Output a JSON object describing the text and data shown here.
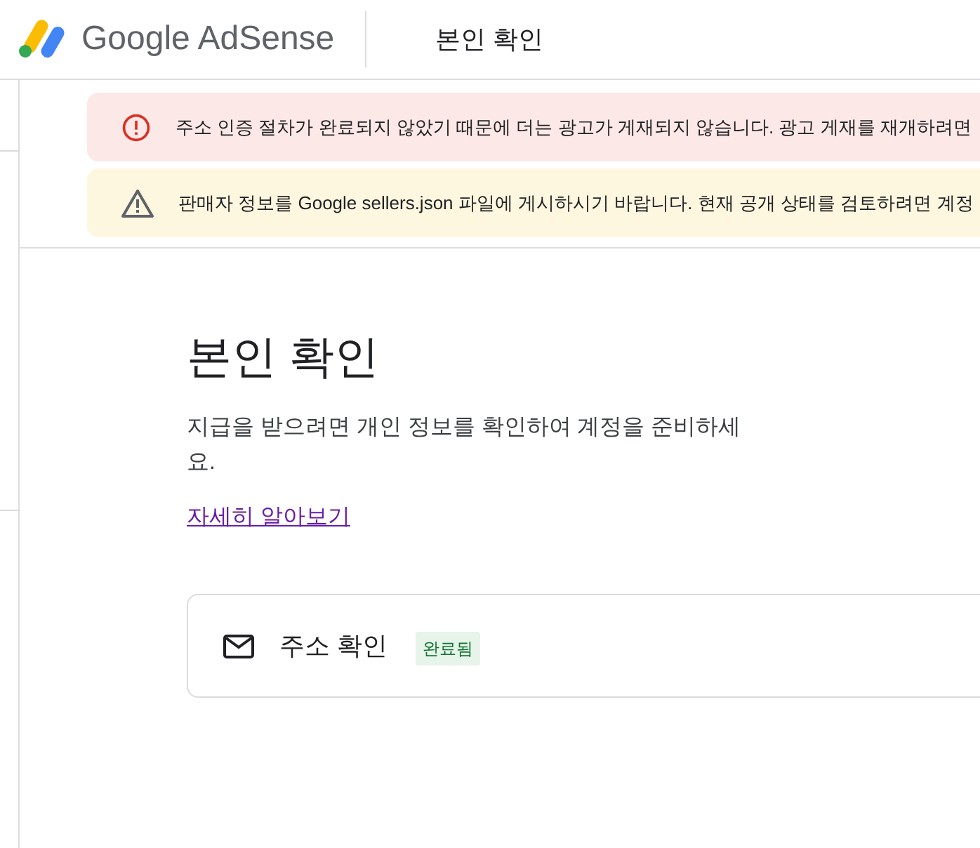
{
  "header": {
    "product": "Google AdSense",
    "page_title": "본인 확인"
  },
  "alerts": [
    {
      "kind": "error",
      "text": "주소 인증 절차가 완료되지 않았기 때문에 더는 광고가 게재되지 않습니다. 광고 게재를 재개하려면"
    },
    {
      "kind": "warning",
      "text": "판매자 정보를 Google sellers.json 파일에 게시하시기 바랍니다. 현재 공개 상태를 검토하려면 계정"
    }
  ],
  "main": {
    "title": "본인 확인",
    "description": "지급을 받으려면 개인 정보를 확인하여 계정을 준비하세요.",
    "link": "자세히 알아보기"
  },
  "steps": [
    {
      "label": "주소 확인",
      "status": "완료됨"
    }
  ]
}
